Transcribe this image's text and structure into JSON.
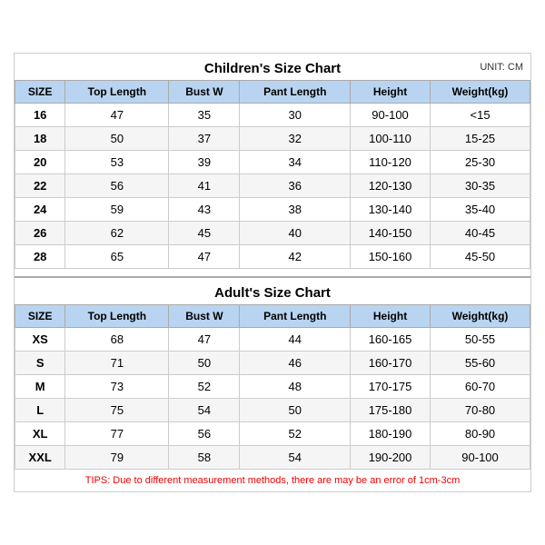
{
  "children": {
    "title": "Children's Size Chart",
    "unit": "UNIT: CM",
    "headers": [
      "SIZE",
      "Top Length",
      "Bust W",
      "Pant Length",
      "Height",
      "Weight(kg)"
    ],
    "rows": [
      [
        "16",
        "47",
        "35",
        "30",
        "90-100",
        "<15"
      ],
      [
        "18",
        "50",
        "37",
        "32",
        "100-110",
        "15-25"
      ],
      [
        "20",
        "53",
        "39",
        "34",
        "110-120",
        "25-30"
      ],
      [
        "22",
        "56",
        "41",
        "36",
        "120-130",
        "30-35"
      ],
      [
        "24",
        "59",
        "43",
        "38",
        "130-140",
        "35-40"
      ],
      [
        "26",
        "62",
        "45",
        "40",
        "140-150",
        "40-45"
      ],
      [
        "28",
        "65",
        "47",
        "42",
        "150-160",
        "45-50"
      ]
    ]
  },
  "adult": {
    "title": "Adult's Size Chart",
    "headers": [
      "SIZE",
      "Top Length",
      "Bust W",
      "Pant Length",
      "Height",
      "Weight(kg)"
    ],
    "rows": [
      [
        "XS",
        "68",
        "47",
        "44",
        "160-165",
        "50-55"
      ],
      [
        "S",
        "71",
        "50",
        "46",
        "160-170",
        "55-60"
      ],
      [
        "M",
        "73",
        "52",
        "48",
        "170-175",
        "60-70"
      ],
      [
        "L",
        "75",
        "54",
        "50",
        "175-180",
        "70-80"
      ],
      [
        "XL",
        "77",
        "56",
        "52",
        "180-190",
        "80-90"
      ],
      [
        "XXL",
        "79",
        "58",
        "54",
        "190-200",
        "90-100"
      ]
    ]
  },
  "tips": "TIPS: Due to different measurement methods, there are may be an error of 1cm-3cm"
}
